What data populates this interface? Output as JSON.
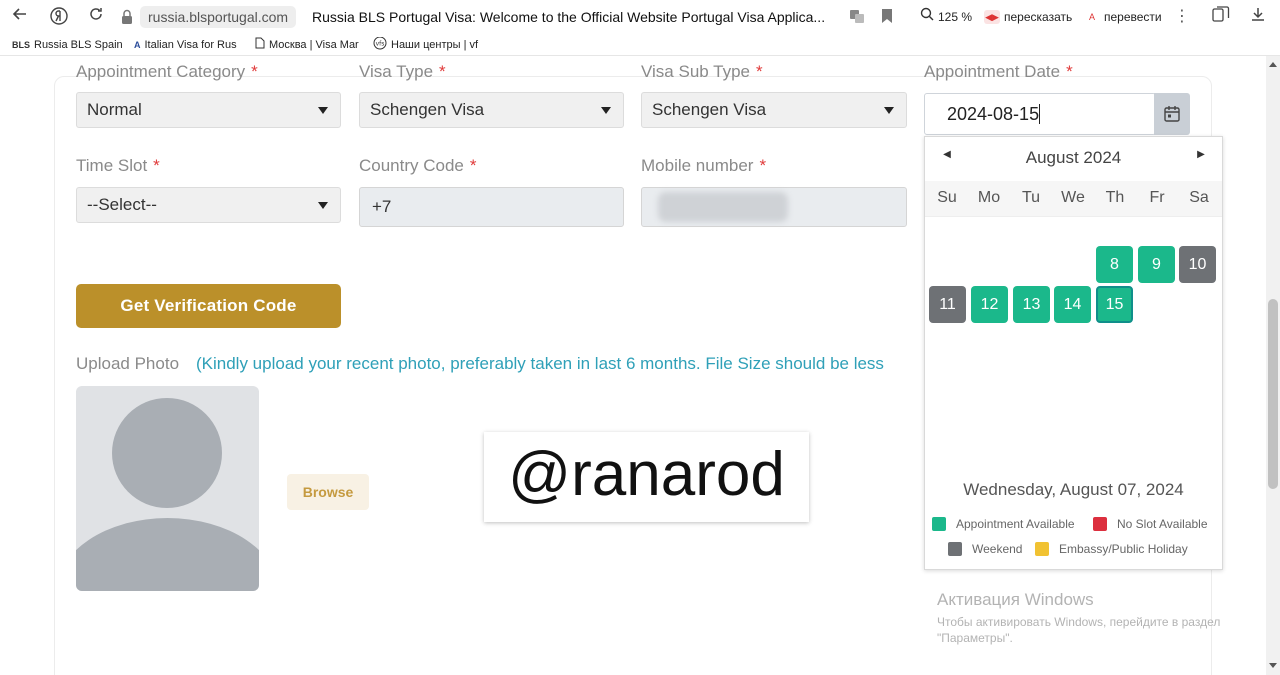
{
  "browser": {
    "url": "russia.blsportugal.com",
    "title": "Russia BLS Portugal Visa: Welcome to the Official Website Portugal Visa Applica...",
    "zoom": "125 %",
    "summarize_label": "пересказать",
    "translate_label": "перевести",
    "bookmarks": [
      {
        "icon": "BLS",
        "label": "Russia BLS Spain V"
      },
      {
        "icon": "A",
        "label": "Italian Visa for Rus"
      },
      {
        "icon": "page",
        "label": "Москва | Visa Mar"
      },
      {
        "icon": "vfs",
        "label": "Наши центры | vf"
      }
    ]
  },
  "form": {
    "appointment_category": {
      "label": "Appointment Category",
      "value": "Normal"
    },
    "visa_type": {
      "label": "Visa Type",
      "value": "Schengen Visa"
    },
    "visa_sub_type": {
      "label": "Visa Sub Type",
      "value": "Schengen Visa"
    },
    "appointment_date": {
      "label": "Appointment Date",
      "value": "2024-08-15"
    },
    "time_slot": {
      "label": "Time Slot",
      "value": "--Select--"
    },
    "country_code": {
      "label": "Country Code",
      "value": "+7"
    },
    "mobile_number": {
      "label": "Mobile number",
      "value": ""
    },
    "required_mark": "*",
    "verify_button": "Get Verification Code",
    "upload": {
      "label": "Upload Photo",
      "note": "(Kindly upload your recent photo, preferably taken in last 6 months. File Size should be less",
      "browse_button": "Browse"
    }
  },
  "watermark": "@ranarod",
  "datepicker": {
    "month_title": "August 2024",
    "weekdays": [
      "Su",
      "Mo",
      "Tu",
      "We",
      "Th",
      "Fr",
      "Sa"
    ],
    "days": [
      {
        "day": "8",
        "status": "available"
      },
      {
        "day": "9",
        "status": "available"
      },
      {
        "day": "10",
        "status": "weekend"
      },
      {
        "day": "11",
        "status": "weekend"
      },
      {
        "day": "12",
        "status": "available"
      },
      {
        "day": "13",
        "status": "available"
      },
      {
        "day": "14",
        "status": "available"
      },
      {
        "day": "15",
        "status": "selected"
      }
    ],
    "today_text": "Wednesday, August 07, 2024",
    "legend": {
      "available": "Appointment Available",
      "no_slot": "No Slot Available",
      "weekend": "Weekend",
      "holiday": "Embassy/Public Holiday"
    },
    "colors": {
      "available": "#1bb88b",
      "no_slot": "#dc2f3e",
      "weekend": "#6e7175",
      "holiday": "#f1c232"
    }
  },
  "windows_activation": {
    "title": "Активация Windows",
    "text": "Чтобы активировать Windows, перейдите в раздел \"Параметры\"."
  }
}
